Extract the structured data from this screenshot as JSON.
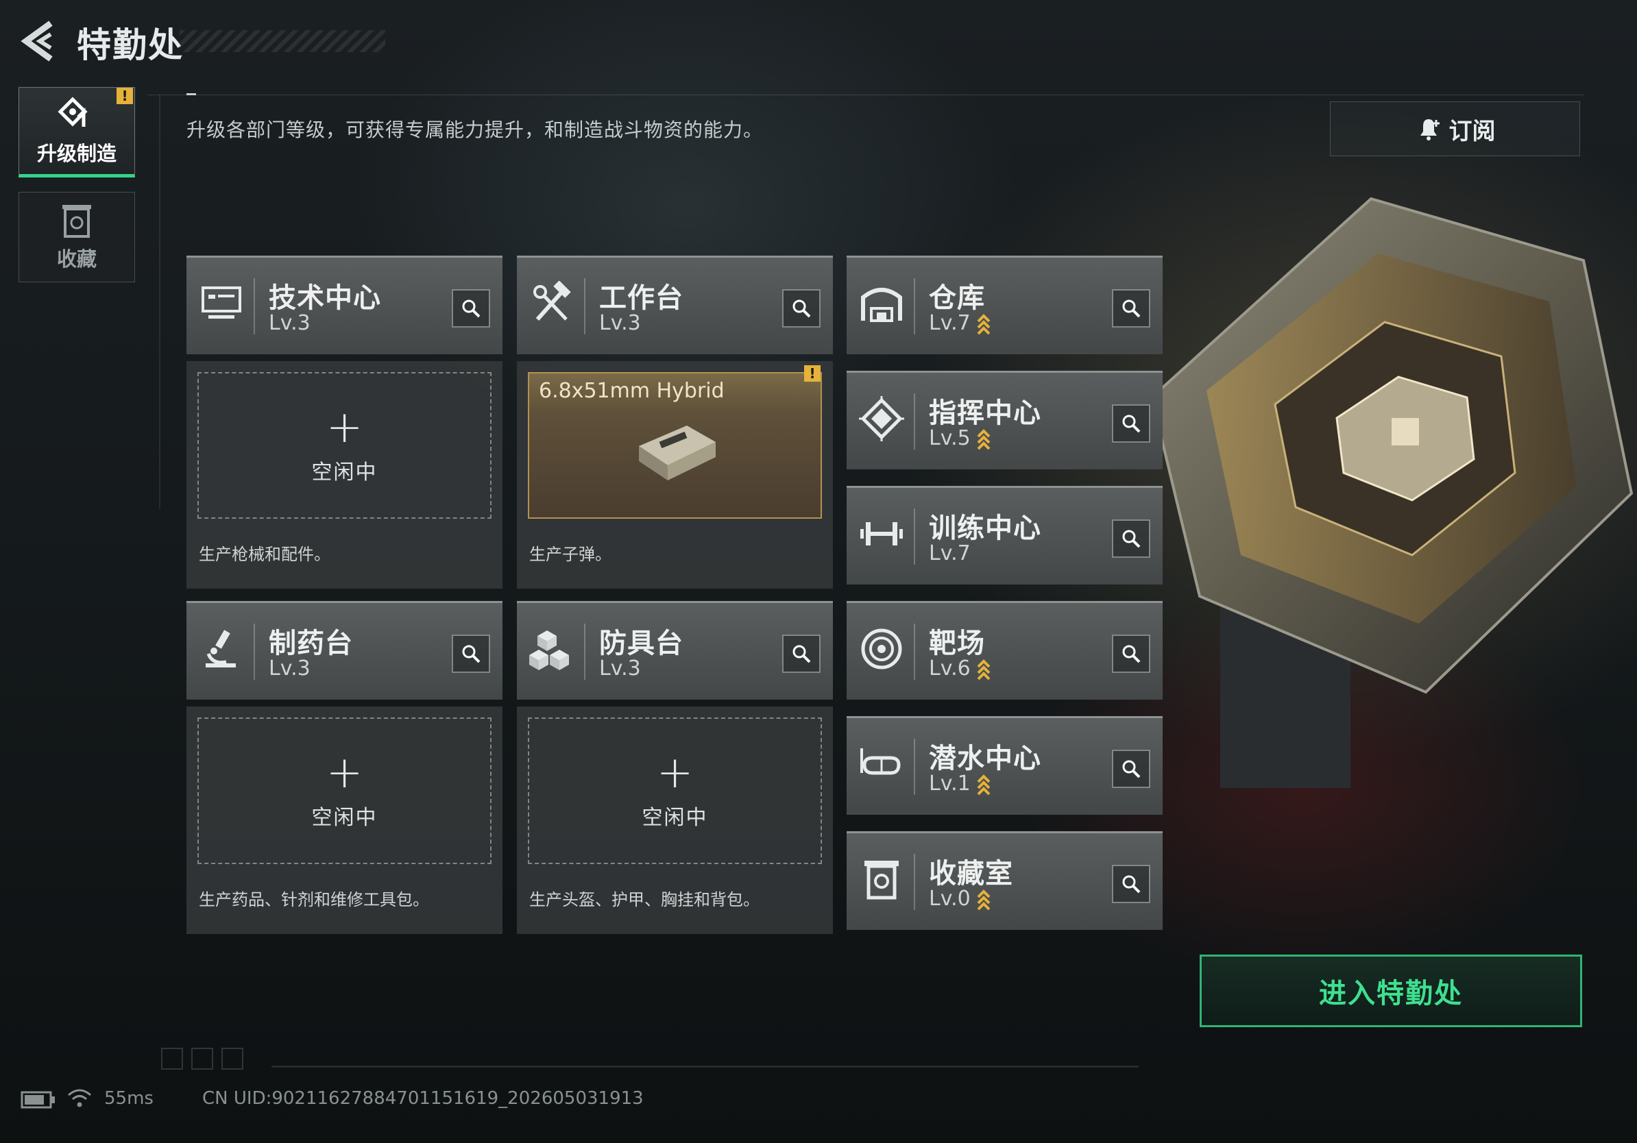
{
  "header": {
    "title": "特勤处"
  },
  "sidebar": {
    "tabs": [
      {
        "label": "升级制造",
        "active": true,
        "alert": "!"
      },
      {
        "label": "收藏",
        "active": false
      }
    ]
  },
  "description": "升级各部门等级，可获得专属能力提升，和制造战斗物资的能力。",
  "subscribe": {
    "label": "订阅"
  },
  "departments": {
    "tech_center": {
      "name": "技术中心",
      "level": "Lv.3",
      "icon": "monitor-icon",
      "upgradable": false
    },
    "workbench": {
      "name": "工作台",
      "level": "Lv.3",
      "icon": "hammer-wrench-icon",
      "upgradable": false
    },
    "pharmacy": {
      "name": "制药台",
      "level": "Lv.3",
      "icon": "microscope-icon",
      "upgradable": false
    },
    "armor_bench": {
      "name": "防具台",
      "level": "Lv.3",
      "icon": "cubes-icon",
      "upgradable": false
    },
    "warehouse": {
      "name": "仓库",
      "level": "Lv.7",
      "icon": "warehouse-icon",
      "upgradable": true
    },
    "command_center": {
      "name": "指挥中心",
      "level": "Lv.5",
      "icon": "chip-icon",
      "upgradable": true
    },
    "training_center": {
      "name": "训练中心",
      "level": "Lv.7",
      "icon": "dumbbell-icon",
      "upgradable": false
    },
    "shooting_range": {
      "name": "靶场",
      "level": "Lv.6",
      "icon": "target-icon",
      "upgradable": true
    },
    "diving_center": {
      "name": "潜水中心",
      "level": "Lv.1",
      "icon": "diving-mask-icon",
      "upgradable": true
    },
    "collection_room": {
      "name": "收藏室",
      "level": "Lv.0",
      "icon": "trash-vault-icon",
      "upgradable": true
    }
  },
  "slots": {
    "tech_center": {
      "status": "空闲中",
      "plus": "+",
      "caption": "生产枪械和配件。"
    },
    "workbench": {
      "product": "6.8x51mm Hybrid",
      "alert": "!",
      "caption": "生产子弹。"
    },
    "pharmacy": {
      "status": "空闲中",
      "plus": "+",
      "caption": "生产药品、针剂和维修工具包。"
    },
    "armor_bench": {
      "status": "空闲中",
      "plus": "+",
      "caption": "生产头盔、护甲、胸挂和背包。"
    }
  },
  "enter_button": {
    "label": "进入特勤处"
  },
  "status_bar": {
    "ping": "55ms",
    "uid": "CN UID:902116278847011516​19_202605031913"
  },
  "colors": {
    "accent_green": "#35d48a",
    "upgrade_gold": "#e6b23a",
    "alert_yellow": "#e6b23a"
  }
}
